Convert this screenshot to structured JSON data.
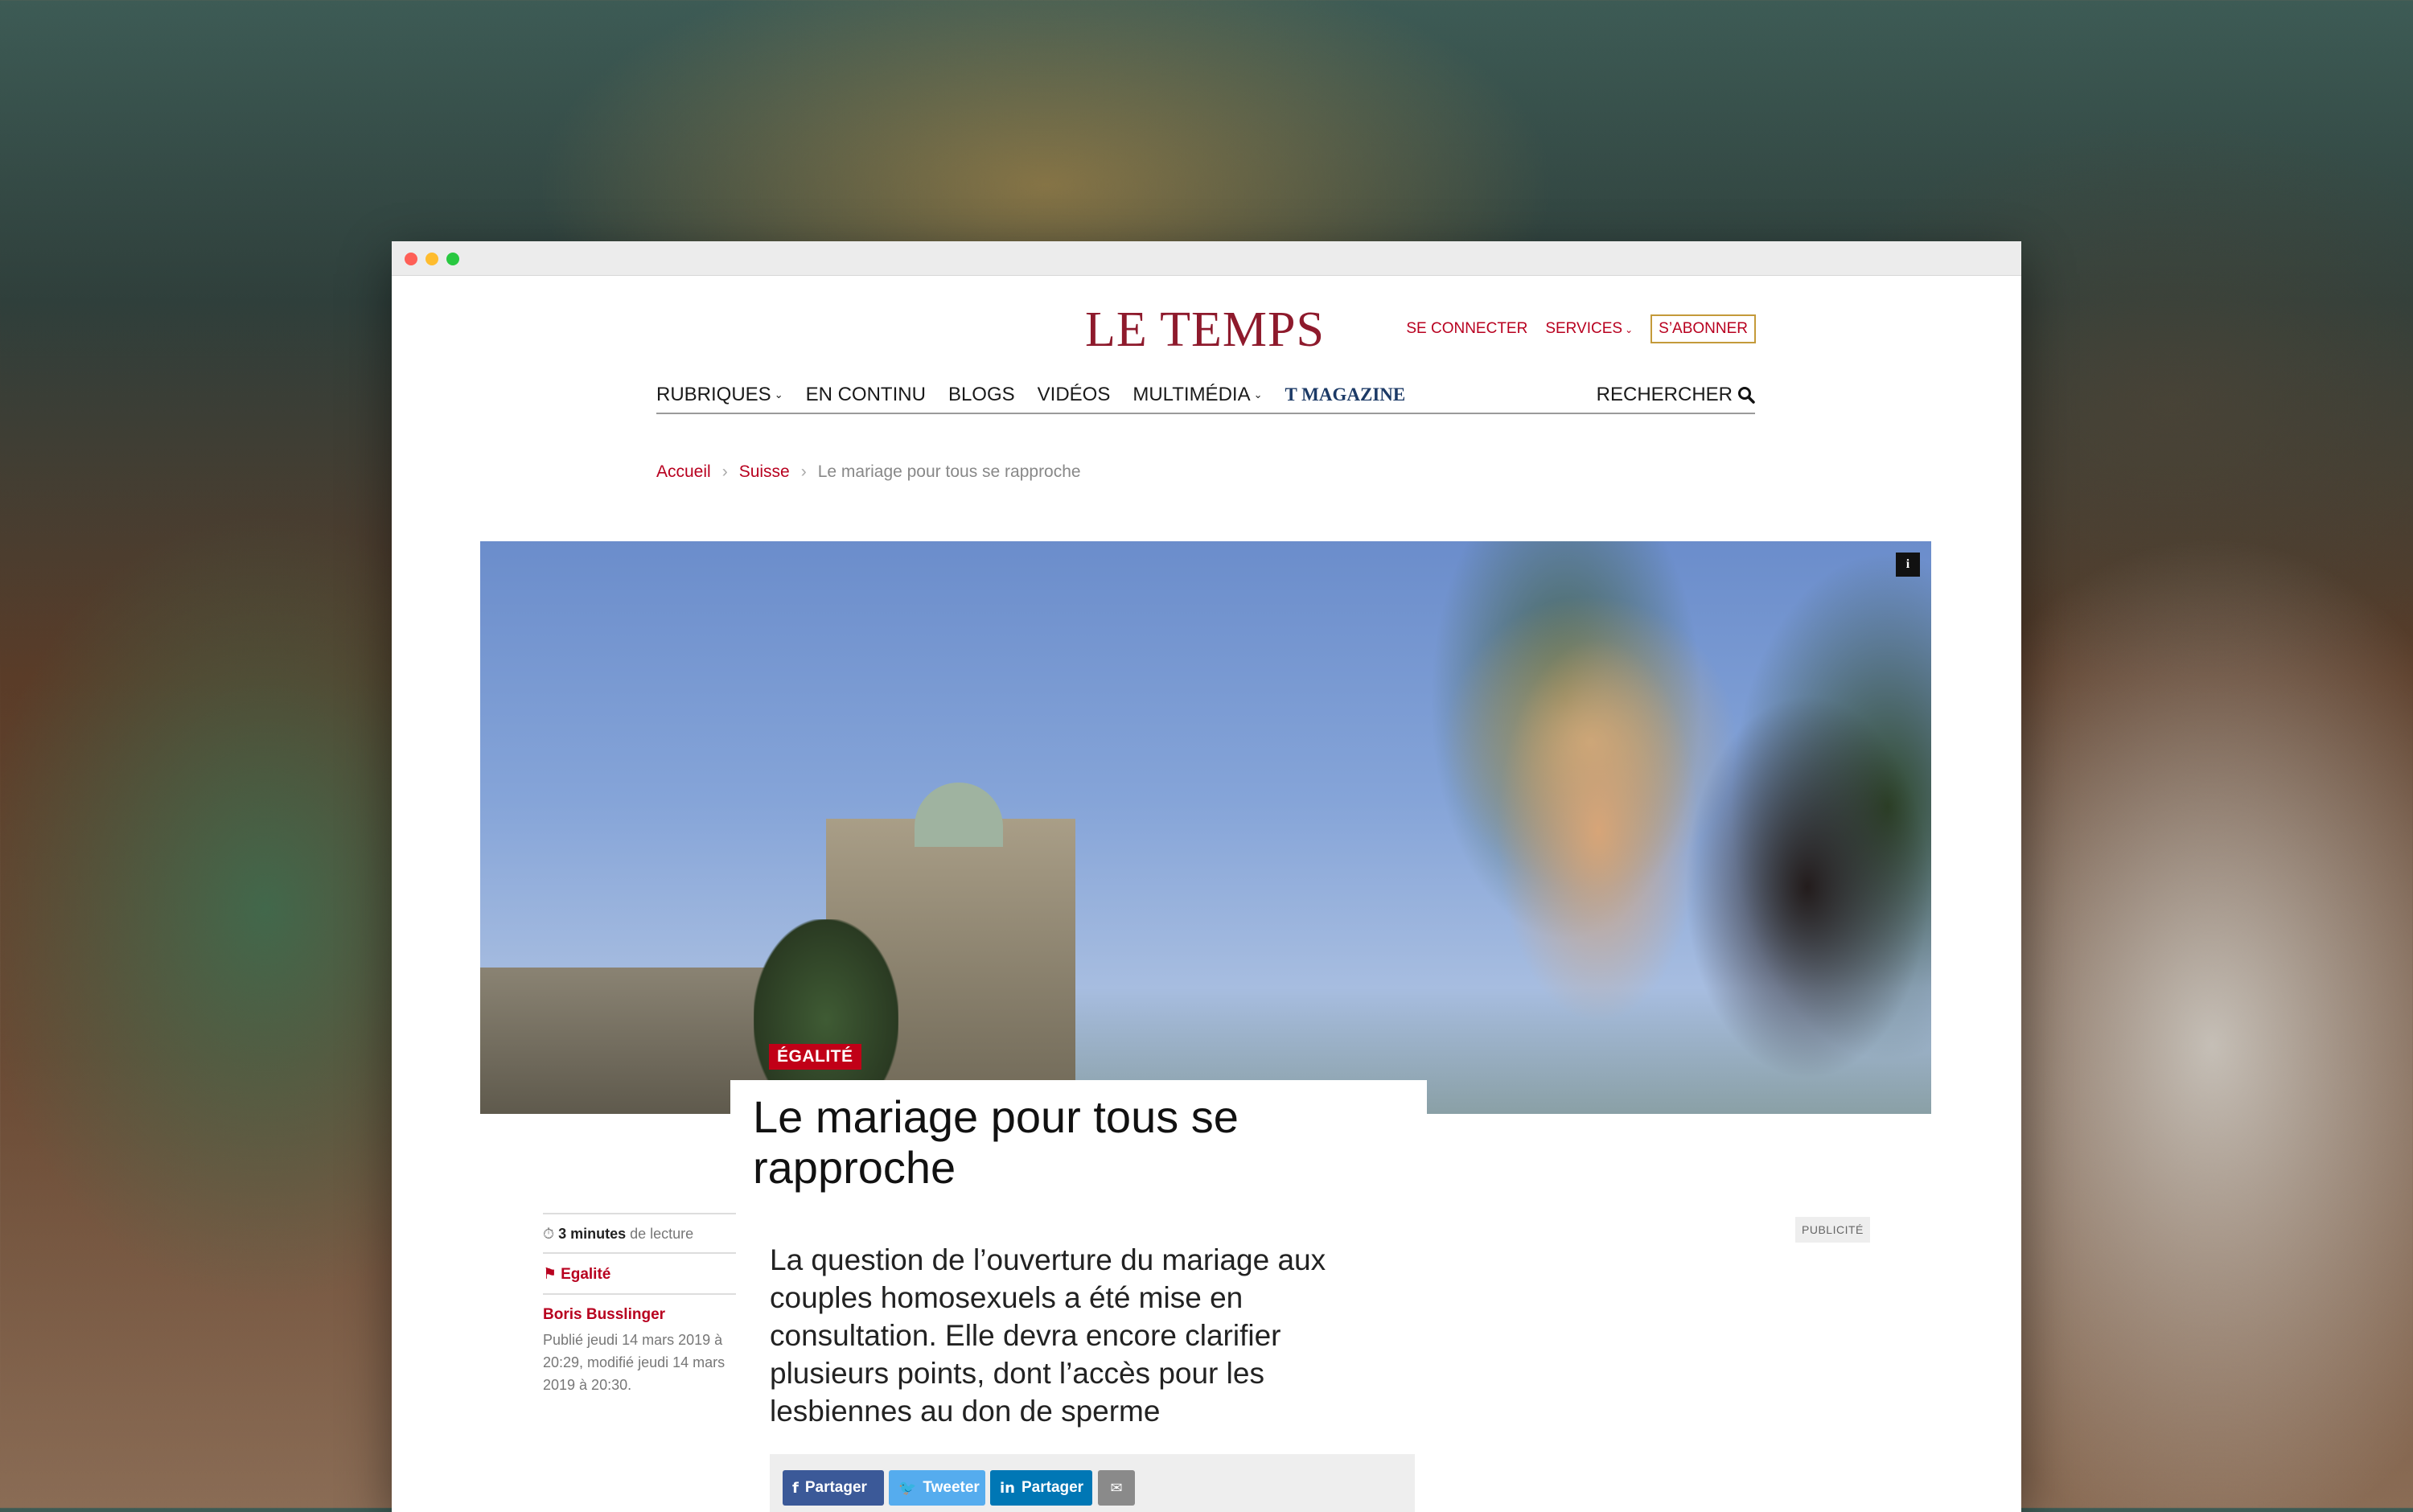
{
  "brand": {
    "logo": "LE TEMPS"
  },
  "topnav": {
    "login": "SE CONNECTER",
    "services": "SERVICES",
    "subscribe": "S’ABONNER"
  },
  "mainnav": {
    "items": [
      "RUBRIQUES",
      "EN CONTINU",
      "BLOGS",
      "VIDÉOS",
      "MULTIMÉDIA"
    ],
    "magazine": "T MAGAZINE",
    "search": "RECHERCHER"
  },
  "breadcrumb": {
    "home": "Accueil",
    "section": "Suisse",
    "current": "Le mariage pour tous se rapproche"
  },
  "hero": {
    "info": "i"
  },
  "article": {
    "category": "ÉGALITÉ",
    "title": "Le mariage pour tous se rapproche",
    "lead": "La question de l’ouverture du mariage aux couples homosexuels a été mise en consultation. Elle devra encore clarifier plusieurs points, dont l’accès pour les lesbiennes au don de sperme"
  },
  "meta": {
    "read_minutes": "3 minutes",
    "read_suffix": "de lecture",
    "tag": "Egalité",
    "author": "Boris Busslinger",
    "published": "Publié jeudi 14 mars 2019 à 20:29, modifié jeudi 14 mars 2019 à 20:30."
  },
  "ad": {
    "label": "PUBLICITÉ"
  },
  "share": {
    "facebook": "Partager",
    "twitter": "Tweeter",
    "linkedin": "Partager"
  },
  "colors": {
    "brand": "#8e1a2c",
    "accent": "#b8001f",
    "category_bg": "#c10017",
    "facebook": "#3b5998",
    "twitter": "#55acee",
    "linkedin": "#0077b5"
  }
}
